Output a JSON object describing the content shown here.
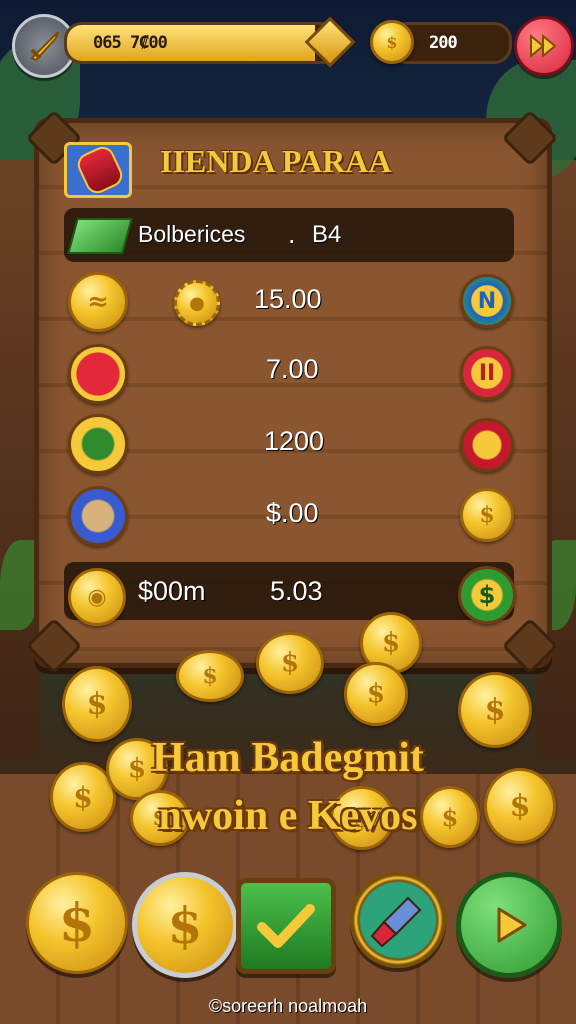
{
  "topbar": {
    "progress_value": "065 7₡00",
    "coins_value": "200",
    "progress_fraction": 0.92
  },
  "shop": {
    "title": "IIENDA PARAA",
    "header_label": "Bolberices",
    "header_dot": ".",
    "header_value": "B4",
    "items": [
      {
        "price": "15.00"
      },
      {
        "price": "7.00"
      },
      {
        "price": "1200"
      },
      {
        "price": "$.00"
      }
    ],
    "footer_row": {
      "label": "$00m",
      "value": "5.03"
    }
  },
  "banner": {
    "line1": "Ham Badegmit",
    "line2": "nwoin e Kevos"
  },
  "footer_text": "©soreerh noalmoah",
  "colors": {
    "gold": "#f6c93a",
    "wood": "#8a5630",
    "dark_wood": "#4a2b12",
    "red_button": "#d9263c",
    "green_button": "#2f9a2f",
    "blue_ring": "#1e63b8"
  },
  "icons": [
    "sword-icon",
    "gem-icon",
    "coin-icon",
    "fast-forward-icon",
    "potion-icon",
    "money-stack-icon",
    "bread-icon",
    "gear-coin-icon",
    "lantern-icon",
    "battery-icon",
    "chest-icon",
    "dollar-icon",
    "pause-icon",
    "check-icon",
    "play-icon"
  ]
}
